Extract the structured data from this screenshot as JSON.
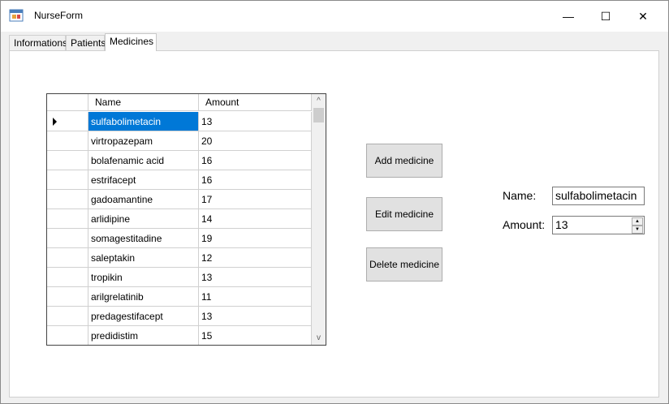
{
  "window": {
    "title": "NurseForm",
    "minimize_glyph": "—",
    "maximize_glyph": "☐",
    "close_glyph": "✕"
  },
  "tabs": [
    {
      "label": "Informations"
    },
    {
      "label": "Patients"
    },
    {
      "label": "Medicines"
    }
  ],
  "active_tab": "Medicines",
  "grid": {
    "columns": [
      {
        "label": "Name"
      },
      {
        "label": "Amount"
      }
    ],
    "rows": [
      {
        "name": "sulfabolimetacin",
        "amount": "13"
      },
      {
        "name": "virtropazepam",
        "amount": "20"
      },
      {
        "name": "bolafenamic acid",
        "amount": "16"
      },
      {
        "name": "estrifacept",
        "amount": "16"
      },
      {
        "name": "gadoamantine",
        "amount": "17"
      },
      {
        "name": "arlidipine",
        "amount": "14"
      },
      {
        "name": "somagestitadine",
        "amount": "19"
      },
      {
        "name": "saleptakin",
        "amount": "12"
      },
      {
        "name": "tropikin",
        "amount": "13"
      },
      {
        "name": "arilgrelatinib",
        "amount": "11"
      },
      {
        "name": "predagestifacept",
        "amount": "13"
      },
      {
        "name": "predidistim",
        "amount": "15"
      }
    ],
    "selected_row": 0,
    "scroll_up_glyph": "^",
    "scroll_down_glyph": "v"
  },
  "buttons": {
    "add": "Add medicine",
    "edit": "Edit medicine",
    "delete": "Delete medicine"
  },
  "form": {
    "name_label": "Name:",
    "name_value": "sulfabolimetacin",
    "amount_label": "Amount:",
    "amount_value": "13",
    "spin_up": "▲",
    "spin_down": "▼"
  },
  "colors": {
    "selection": "#0078d7",
    "button_face": "#e1e1e1"
  },
  "icons": {
    "app": "form-icon"
  }
}
